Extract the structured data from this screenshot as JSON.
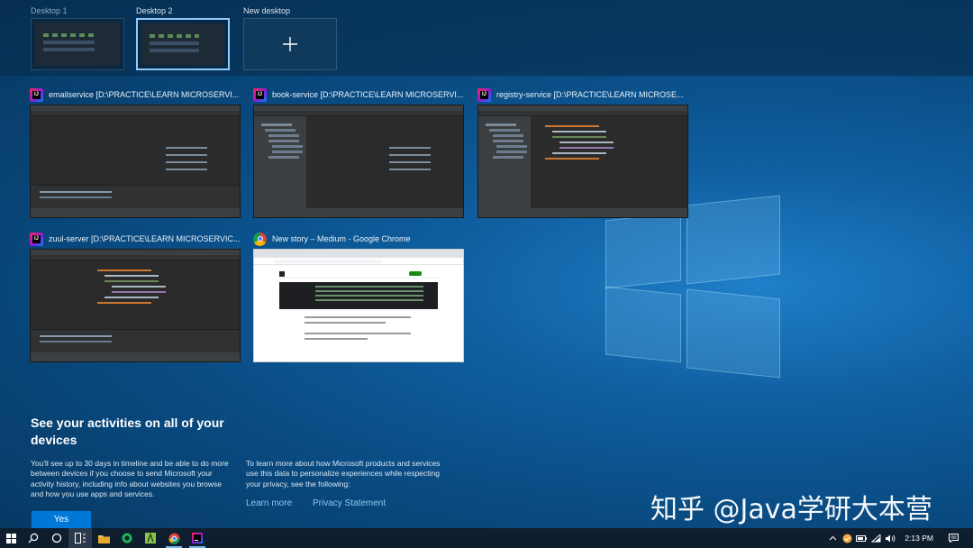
{
  "desktops": [
    {
      "label": "Desktop 1"
    },
    {
      "label": "Desktop 2"
    },
    {
      "label": "New desktop"
    }
  ],
  "windows": [
    {
      "title": "emailservice [D:\\PRACTICE\\LEARN MICROSERVI...",
      "app": "intellij-icon"
    },
    {
      "title": "book-service [D:\\PRACTICE\\LEARN MICROSERVI...",
      "app": "intellij-icon"
    },
    {
      "title": "registry-service [D:\\PRACTICE\\LEARN MICROSE...",
      "app": "intellij-icon"
    },
    {
      "title": "zuul-server [D:\\PRACTICE\\LEARN MICROSERVIC...",
      "app": "intellij-icon"
    },
    {
      "title": "New story – Medium - Google Chrome",
      "app": "chrome-icon"
    }
  ],
  "timeline": {
    "title": "See your activities on all of your devices",
    "body": "You'll see up to 30 days in timeline and be able to do more between devices if you choose to send Microsoft your activity history, including info about websites you browse and how you use apps and services.",
    "privacy_body": "To learn more about how Microsoft products and services use this data to personalize experiences while respecting your privacy, see the following:",
    "learn_more": "Learn more",
    "privacy_statement": "Privacy Statement",
    "yes_label": "Yes"
  },
  "watermark": "知乎 @Java学研大本营",
  "taskbar": {
    "apps": [
      "file-explorer-icon",
      "spotify-icon",
      "android-studio-icon",
      "chrome-icon",
      "intellij-icon"
    ],
    "time": "2:13 PM"
  },
  "colors": {
    "accent": "#0078d7",
    "link": "#8fc6f0",
    "taskbar": "#0e1e2e"
  }
}
